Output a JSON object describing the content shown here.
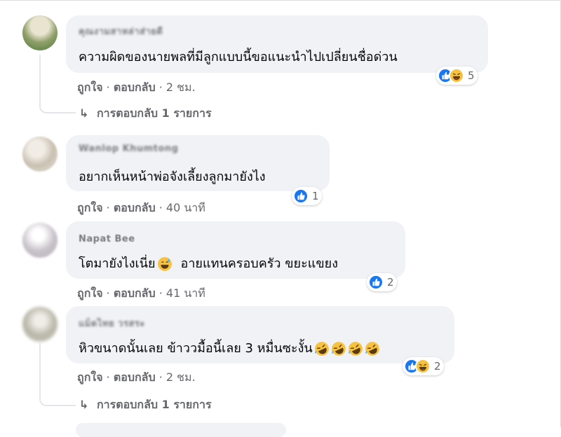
{
  "comments": [
    {
      "author": "คุณงามสาหล่าส่ายดี",
      "text": "ความผิดของนายพลที่มีลูกแบบนี้ขอแนะนำไปเปลี่ยนชื่อด่วน",
      "like_label": "ถูกใจ",
      "reply_label": "ตอบกลับ",
      "time": "2 ชม.",
      "reaction_icons": [
        "like-icon",
        "haha-icon"
      ],
      "reaction_count": "5",
      "replies_label": "การตอบกลับ 1 รายการ"
    },
    {
      "author": "Wanlop Khumtong",
      "text": "อยากเห็นหน้าพ่อจังเลี้ยงลูกมายังไง",
      "like_label": "ถูกใจ",
      "reply_label": "ตอบกลับ",
      "time": "40 นาที",
      "reaction_icons": [
        "like-icon"
      ],
      "reaction_count": "1"
    },
    {
      "author": "Napat Bee",
      "text": "โตมายังไงเนี่ย",
      "text_tail": "อายแทนครอบครัว ขยะแขยง",
      "like_label": "ถูกใจ",
      "reply_label": "ตอบกลับ",
      "time": "41 นาที",
      "reaction_icons": [
        "like-icon"
      ],
      "reaction_count": "2"
    },
    {
      "author": "แม็ดไทย วรสระ",
      "text": "หิวขนาดนั้นเลย ข้าววมื้อนี้เลย 3 หมื่นซะงั้น",
      "like_label": "ถูกใจ",
      "reply_label": "ตอบกลับ",
      "time": "2 ชม.",
      "reaction_icons": [
        "like-icon",
        "haha-icon"
      ],
      "reaction_count": "2",
      "replies_label": "การตอบกลับ 1 รายการ"
    }
  ],
  "separator": " · ",
  "reply_arrow": "↳",
  "colors": {
    "bubble": "#f0f2f5",
    "meta": "#65676b",
    "like": "#1877f2",
    "haha": "#f7c240"
  }
}
